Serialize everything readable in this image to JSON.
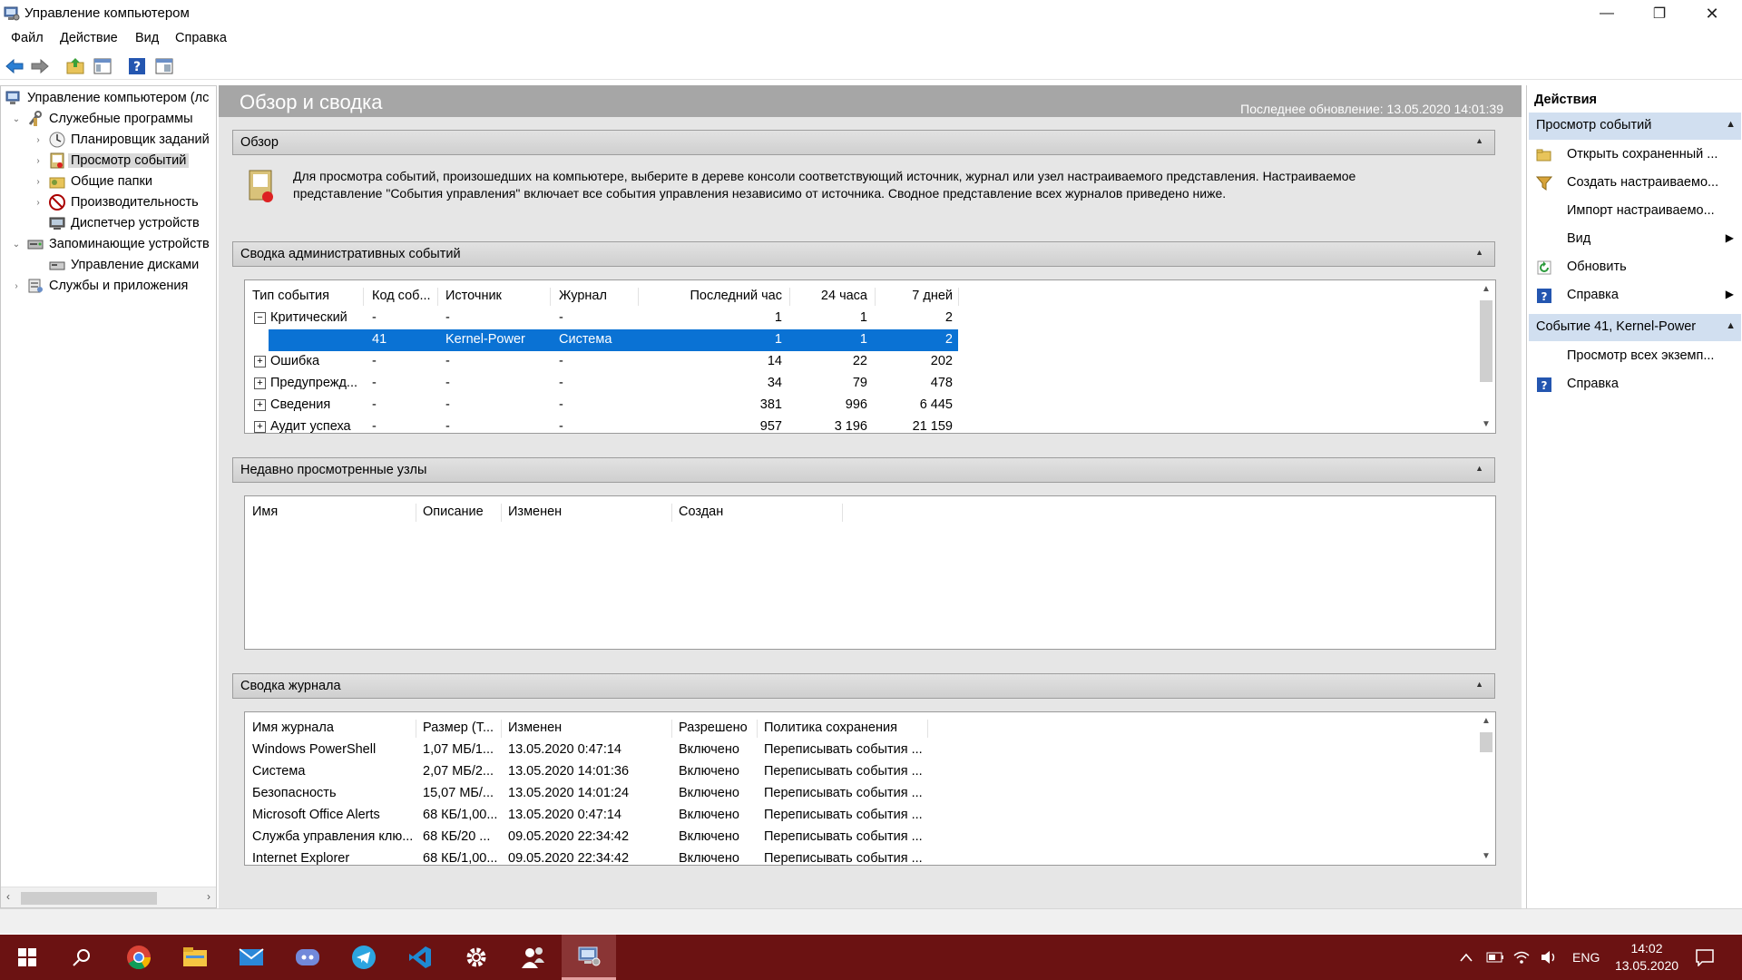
{
  "window": {
    "title": "Управление компьютером",
    "minimize": "—",
    "restore": "❐",
    "close": "✕"
  },
  "menu": [
    "Файл",
    "Действие",
    "Вид",
    "Справка"
  ],
  "toolbar": {
    "icons": [
      "back-arrow-icon",
      "forward-arrow-icon",
      "up-folder-icon",
      "show-hide-tree-icon",
      "help-icon",
      "properties-icon"
    ]
  },
  "tree": {
    "nodes": [
      {
        "label": "Управление компьютером (лс",
        "icon": "computer-management-icon",
        "level": 0,
        "expander": ""
      },
      {
        "label": "Служебные программы",
        "icon": "tools-icon",
        "level": 1,
        "expander": "⌄"
      },
      {
        "label": "Планировщик заданий",
        "icon": "clock-icon",
        "level": 2,
        "expander": "›"
      },
      {
        "label": "Просмотр событий",
        "icon": "event-viewer-icon",
        "level": 2,
        "expander": "›",
        "selected": true
      },
      {
        "label": "Общие папки",
        "icon": "shared-folder-icon",
        "level": 2,
        "expander": "›"
      },
      {
        "label": "Производительность",
        "icon": "performance-icon",
        "level": 2,
        "expander": "›"
      },
      {
        "label": "Диспетчер устройств",
        "icon": "device-manager-icon",
        "level": 2,
        "expander": ""
      },
      {
        "label": "Запоминающие устройств",
        "icon": "storage-icon",
        "level": 1,
        "expander": "⌄"
      },
      {
        "label": "Управление дисками",
        "icon": "disk-icon",
        "level": 2,
        "expander": ""
      },
      {
        "label": "Службы и приложения",
        "icon": "services-icon",
        "level": 1,
        "expander": "›"
      }
    ]
  },
  "center": {
    "title": "Обзор и сводка",
    "last_update": "Последнее обновление: 13.05.2020 14:01:39",
    "overview": {
      "title": "Обзор",
      "text_line1": "Для просмотра событий, произошедших на компьютере, выберите в дереве консоли соответствующий источник, журнал или узел настраиваемого представления. Настраиваемое",
      "text_line2": "представление \"События управления\" включает все события управления независимо от источника. Сводное представление всех журналов приведено ниже."
    },
    "admin_summary": {
      "title": "Сводка административных событий",
      "headers": [
        "Тип события",
        "Код соб...",
        "Источник",
        "Журнал",
        "Последний час",
        "24 часа",
        "7 дней"
      ],
      "rows": [
        {
          "expander": "−",
          "type": "Критический",
          "code": "-",
          "source": "-",
          "log": "-",
          "hour": "1",
          "day": "1",
          "week": "2"
        },
        {
          "expander": "",
          "type": "",
          "code": "41",
          "source": "Kernel-Power",
          "log": "Система",
          "hour": "1",
          "day": "1",
          "week": "2",
          "selected": true
        },
        {
          "expander": "+",
          "type": "Ошибка",
          "code": "-",
          "source": "-",
          "log": "-",
          "hour": "14",
          "day": "22",
          "week": "202"
        },
        {
          "expander": "+",
          "type": "Предупрежд...",
          "code": "-",
          "source": "-",
          "log": "-",
          "hour": "34",
          "day": "79",
          "week": "478"
        },
        {
          "expander": "+",
          "type": "Сведения",
          "code": "-",
          "source": "-",
          "log": "-",
          "hour": "381",
          "day": "996",
          "week": "6 445"
        },
        {
          "expander": "+",
          "type": "Аудит успеха",
          "code": "-",
          "source": "-",
          "log": "-",
          "hour": "957",
          "day": "3 196",
          "week": "21 159"
        }
      ]
    },
    "recent": {
      "title": "Недавно просмотренные узлы",
      "headers": [
        "Имя",
        "Описание",
        "Изменен",
        "Создан"
      ]
    },
    "log_summary": {
      "title": "Сводка журнала",
      "headers": [
        "Имя журнала",
        "Размер (Т...",
        "Изменен",
        "Разрешено",
        "Политика сохранения"
      ],
      "rows": [
        [
          "Windows PowerShell",
          "1,07 МБ/1...",
          "13.05.2020 0:47:14",
          "Включено",
          "Переписывать события ..."
        ],
        [
          "Система",
          "2,07 МБ/2...",
          "13.05.2020 14:01:36",
          "Включено",
          "Переписывать события ..."
        ],
        [
          "Безопасность",
          "15,07 МБ/...",
          "13.05.2020 14:01:24",
          "Включено",
          "Переписывать события ..."
        ],
        [
          "Microsoft Office Alerts",
          "68 КБ/1,00...",
          "13.05.2020 0:47:14",
          "Включено",
          "Переписывать события ..."
        ],
        [
          "Служба управления клю...",
          "68 КБ/20 ...",
          "09.05.2020 22:34:42",
          "Включено",
          "Переписывать события ..."
        ],
        [
          "Internet Explorer",
          "68 КБ/1,00...",
          "09.05.2020 22:34:42",
          "Включено",
          "Переписывать события ..."
        ]
      ]
    }
  },
  "actions": {
    "title": "Действия",
    "group1": {
      "title": "Просмотр событий",
      "items": [
        {
          "label": "Открыть сохраненный ...",
          "icon": "open-folder-icon",
          "submenu": ""
        },
        {
          "label": "Создать настраиваемо...",
          "icon": "filter-icon",
          "submenu": ""
        },
        {
          "label": "Импорт настраиваемо...",
          "icon": "",
          "submenu": ""
        },
        {
          "label": "Вид",
          "icon": "",
          "submenu": "▶"
        },
        {
          "label": "Обновить",
          "icon": "refresh-icon",
          "submenu": ""
        },
        {
          "label": "Справка",
          "icon": "help-icon",
          "submenu": "▶"
        }
      ]
    },
    "group2": {
      "title": "Событие 41, Kernel-Power",
      "items": [
        {
          "label": "Просмотр всех экземп...",
          "icon": "",
          "submenu": ""
        },
        {
          "label": "Справка",
          "icon": "help-icon",
          "submenu": ""
        }
      ]
    }
  },
  "taskbar": {
    "icons": [
      "windows-start-icon",
      "search-icon",
      "chrome-icon",
      "file-explorer-icon",
      "mail-icon",
      "discord-icon",
      "telegram-icon",
      "vscode-icon",
      "settings-icon",
      "people-icon",
      "computer-management-app-icon"
    ],
    "lang": "ENG",
    "time": "14:02",
    "date": "13.05.2020"
  },
  "colors": {
    "selection": "#0a72d4",
    "header_bar": "#a6a6a6",
    "action_band": "#d1dff0",
    "taskbar": "#6b1212"
  }
}
